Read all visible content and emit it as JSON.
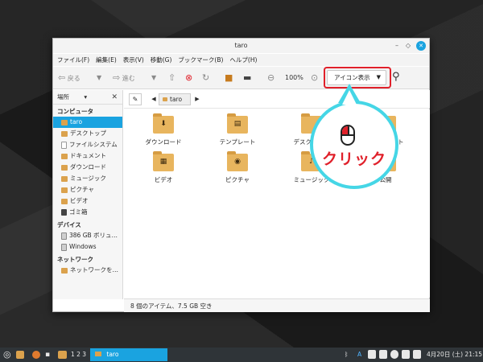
{
  "window": {
    "title": "taro",
    "menu": [
      "ファイル(F)",
      "編集(E)",
      "表示(V)",
      "移動(G)",
      "ブックマーク(B)",
      "ヘルプ(H)"
    ]
  },
  "toolbar": {
    "back_label": "戻る",
    "forward_label": "進む",
    "zoom": "100%",
    "view_mode": "アイコン表示"
  },
  "sidebar": {
    "header": "場所",
    "sections": {
      "computer": "コンピュータ",
      "devices": "デバイス",
      "network": "ネットワーク"
    },
    "computer_items": [
      "taro",
      "デスクトップ",
      "ファイルシステム",
      "ドキュメント",
      "ダウンロード",
      "ミュージック",
      "ピクチャ",
      "ビデオ",
      "ゴミ箱"
    ],
    "device_items": [
      "386 GB ボリュ…",
      "Windows"
    ],
    "network_items": [
      "ネットワークを…"
    ]
  },
  "location": {
    "crumb": "taro"
  },
  "files": [
    {
      "name": "ダウンロード",
      "icon": "download-icon"
    },
    {
      "name": "テンプレート",
      "icon": "template-icon"
    },
    {
      "name": "デスクトップ",
      "icon": "folder-icon"
    },
    {
      "name": "ドキュメント",
      "icon": "document-icon"
    },
    {
      "name": "ビデオ",
      "icon": "video-icon"
    },
    {
      "name": "ピクチャ",
      "icon": "camera-icon"
    },
    {
      "name": "ミュージック",
      "icon": "music-icon"
    },
    {
      "name": "公開",
      "icon": "share-icon"
    }
  ],
  "status": "8 個のアイテム、7.5 GB 空き",
  "callout": {
    "text": "クリック"
  },
  "taskbar": {
    "workspaces": "1 2 3",
    "window_label": "taro",
    "ime": "A",
    "datetime": "4月20日 (土) 21:15"
  },
  "colors": {
    "accent": "#1aa3e0",
    "highlight": "#e0202a",
    "callout_border": "#45d6e6",
    "folder": "#e8b55e"
  }
}
